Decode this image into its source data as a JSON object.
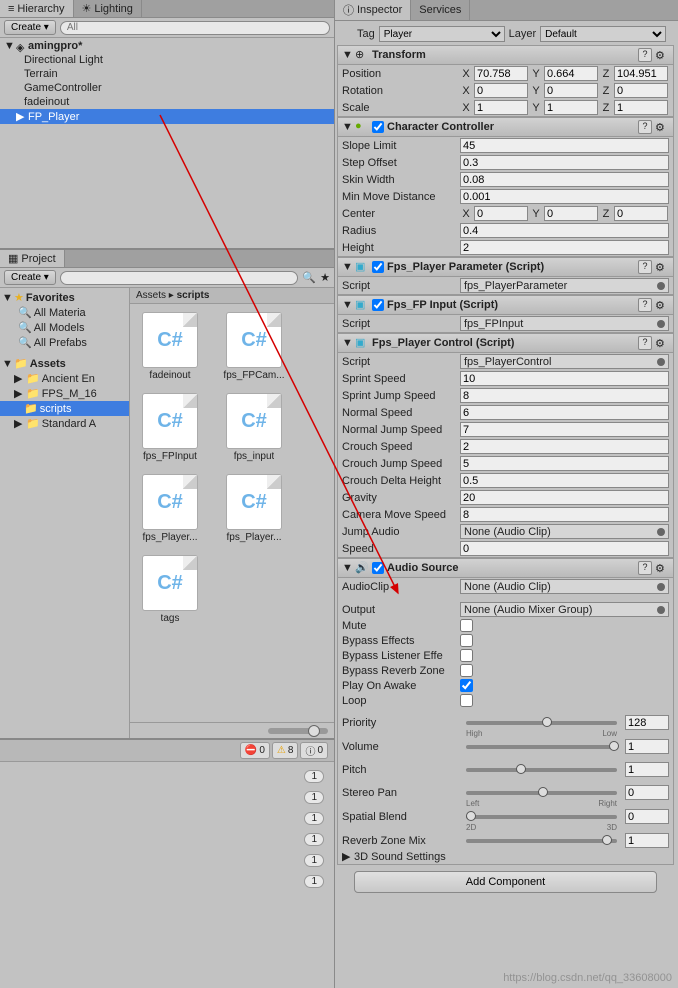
{
  "hierarchy": {
    "tab": "Hierarchy",
    "lighting_tab": "Lighting",
    "create": "Create",
    "search_placeholder": "All",
    "scene": "amingpro*",
    "items": [
      "Directional Light",
      "Terrain",
      "GameController",
      "fadeinout",
      "FP_Player"
    ]
  },
  "project": {
    "tab": "Project",
    "create": "Create",
    "favorites": "Favorites",
    "fav_items": [
      "All Materia",
      "All Models",
      "All Prefabs"
    ],
    "assets": "Assets",
    "asset_folders": [
      "Ancient En",
      "FPS_M_16",
      "scripts",
      "Standard A"
    ],
    "breadcrumb": [
      "Assets",
      "scripts"
    ],
    "files": [
      "fadeinout",
      "fps_FPCam...",
      "fps_FPInput",
      "fps_input",
      "fps_Player...",
      "fps_Player...",
      "tags"
    ]
  },
  "console": {
    "errors": "0",
    "warnings": "8",
    "info": "0",
    "row_count": "1"
  },
  "inspector": {
    "tab": "Inspector",
    "services_tab": "Services",
    "tag_label": "Tag",
    "tag_value": "Player",
    "layer_label": "Layer",
    "layer_value": "Default",
    "transform": {
      "title": "Transform",
      "position": "Position",
      "rotation": "Rotation",
      "scale": "Scale",
      "px": "70.758",
      "py": "0.664",
      "pz": "104.951",
      "rx": "0",
      "ry": "0",
      "rz": "0",
      "sx": "1",
      "sy": "1",
      "sz": "1"
    },
    "charcontroller": {
      "title": "Character Controller",
      "slope_limit": "Slope Limit",
      "slope_limit_v": "45",
      "step_offset": "Step Offset",
      "step_offset_v": "0.3",
      "skin_width": "Skin Width",
      "skin_width_v": "0.08",
      "min_move": "Min Move Distance",
      "min_move_v": "0.001",
      "center": "Center",
      "cx": "0",
      "cy": "0",
      "cz": "0",
      "radius": "Radius",
      "radius_v": "0.4",
      "height": "Height",
      "height_v": "2"
    },
    "fps_param": {
      "title": "Fps_Player Parameter (Script)",
      "script": "Script",
      "script_v": "fps_PlayerParameter"
    },
    "fps_input": {
      "title": "Fps_FP Input (Script)",
      "script": "Script",
      "script_v": "fps_FPInput"
    },
    "fps_control": {
      "title": "Fps_Player Control (Script)",
      "script": "Script",
      "script_v": "fps_PlayerControl",
      "sprint_speed": "Sprint Speed",
      "sprint_speed_v": "10",
      "sprint_jump": "Sprint Jump Speed",
      "sprint_jump_v": "8",
      "normal_speed": "Normal Speed",
      "normal_speed_v": "6",
      "normal_jump": "Normal Jump Speed",
      "normal_jump_v": "7",
      "crouch_speed": "Crouch Speed",
      "crouch_speed_v": "2",
      "crouch_jump": "Crouch Jump Speed",
      "crouch_jump_v": "5",
      "crouch_delta": "Crouch Delta Height",
      "crouch_delta_v": "0.5",
      "gravity": "Gravity",
      "gravity_v": "20",
      "cam_move": "Camera Move Speed",
      "cam_move_v": "8",
      "jump_audio": "Jump Audio",
      "jump_audio_v": "None (Audio Clip)",
      "speed": "Speed",
      "speed_v": "0"
    },
    "audio": {
      "title": "Audio Source",
      "clip": "AudioClip",
      "clip_v": "None (Audio Clip)",
      "output": "Output",
      "output_v": "None (Audio Mixer Group)",
      "mute": "Mute",
      "bypass_fx": "Bypass Effects",
      "bypass_listener": "Bypass Listener Effe",
      "bypass_reverb": "Bypass Reverb Zone",
      "play_awake": "Play On Awake",
      "loop": "Loop",
      "priority": "Priority",
      "priority_v": "128",
      "priority_lo": "High",
      "priority_hi": "Low",
      "volume": "Volume",
      "volume_v": "1",
      "pitch": "Pitch",
      "pitch_v": "1",
      "stereo": "Stereo Pan",
      "stereo_v": "0",
      "stereo_lo": "Left",
      "stereo_hi": "Right",
      "spatial": "Spatial Blend",
      "spatial_v": "0",
      "spatial_lo": "2D",
      "spatial_hi": "3D",
      "reverb": "Reverb Zone Mix",
      "reverb_v": "1",
      "sound3d": "3D Sound Settings"
    },
    "add_component": "Add Component"
  },
  "watermark": "https://blog.csdn.net/qq_33608000"
}
